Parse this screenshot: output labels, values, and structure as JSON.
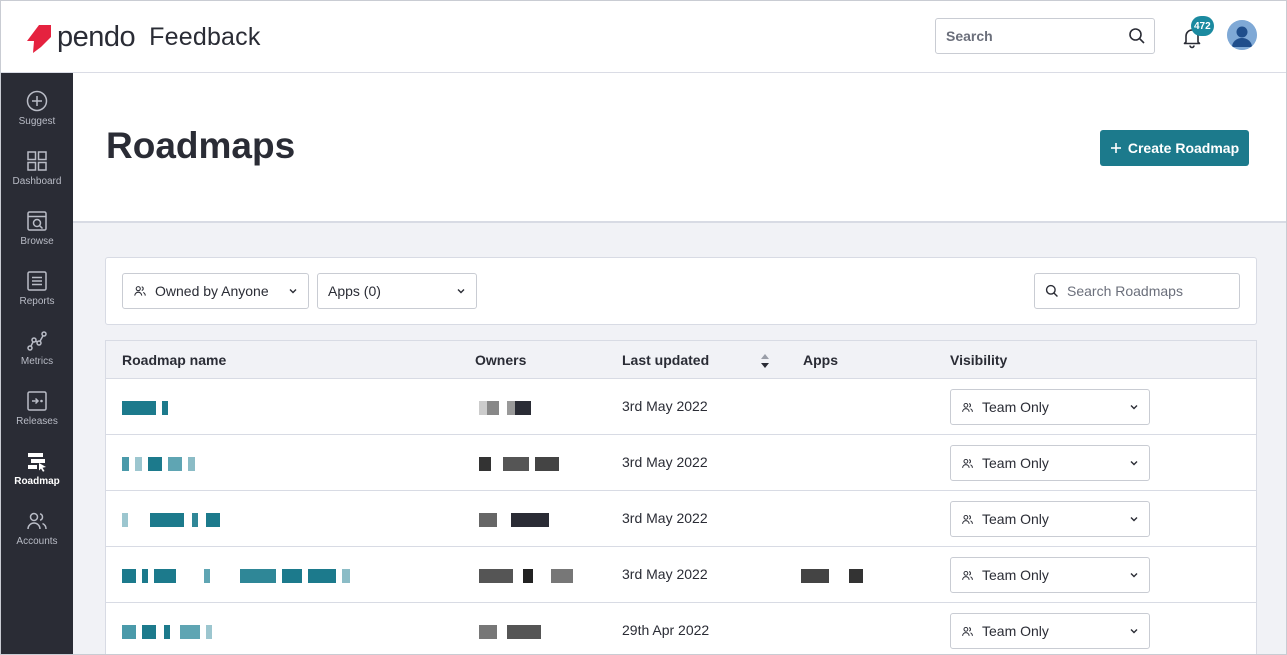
{
  "header": {
    "logo_word": "pendo",
    "product": "Feedback",
    "search_placeholder": "Search",
    "notification_count": "472",
    "brand_color": "#e5223f"
  },
  "sidebar": {
    "items": [
      {
        "label": "Suggest",
        "icon": "plus-circle-icon"
      },
      {
        "label": "Dashboard",
        "icon": "grid-icon"
      },
      {
        "label": "Browse",
        "icon": "browse-icon"
      },
      {
        "label": "Reports",
        "icon": "list-icon"
      },
      {
        "label": "Metrics",
        "icon": "metrics-icon"
      },
      {
        "label": "Releases",
        "icon": "releases-icon"
      },
      {
        "label": "Roadmap",
        "icon": "roadmap-icon",
        "active": true
      },
      {
        "label": "Accounts",
        "icon": "people-icon"
      }
    ]
  },
  "main": {
    "title": "Roadmaps",
    "create_button": "Create Roadmap",
    "filters": {
      "owner": "Owned by Anyone",
      "apps": "Apps (0)",
      "search_placeholder": "Search Roadmaps"
    },
    "table": {
      "columns": [
        "Roadmap name",
        "Owners",
        "Last updated",
        "Apps",
        "Visibility"
      ],
      "rows": [
        {
          "last_updated": "3rd May 2022",
          "visibility": "Team Only"
        },
        {
          "last_updated": "3rd May 2022",
          "visibility": "Team Only"
        },
        {
          "last_updated": "3rd May 2022",
          "visibility": "Team Only"
        },
        {
          "last_updated": "3rd May 2022",
          "visibility": "Team Only"
        },
        {
          "last_updated": "29th Apr 2022",
          "visibility": "Team Only"
        }
      ]
    }
  },
  "colors": {
    "accent": "#1c7a8c",
    "sidebar": "#2a2c35"
  }
}
